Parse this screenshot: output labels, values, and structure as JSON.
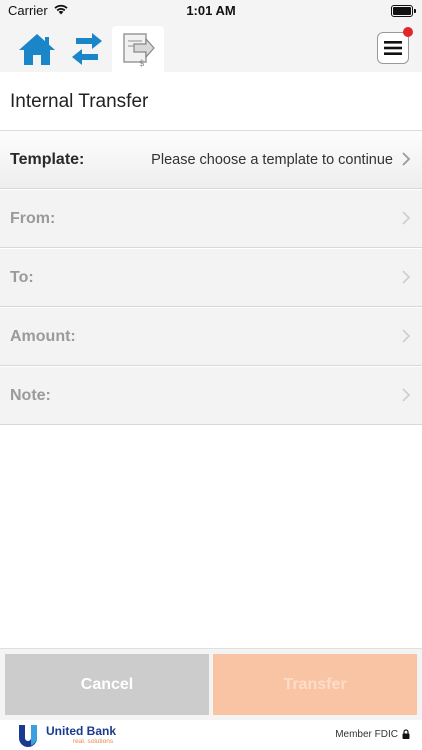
{
  "status_bar": {
    "carrier": "Carrier",
    "time": "1:01 AM"
  },
  "toolbar": {
    "items": [
      {
        "icon": "home-icon"
      },
      {
        "icon": "transfer-arrows-icon"
      },
      {
        "icon": "transfer-template-icon",
        "selected": true
      }
    ],
    "menu_icon": "hamburger-menu-icon",
    "notification_color": "#e32626"
  },
  "page": {
    "title": "Internal Transfer"
  },
  "form": {
    "rows": [
      {
        "label": "Template:",
        "value": "Please choose a template to continue",
        "enabled": true
      },
      {
        "label": "From:",
        "value": "",
        "enabled": false
      },
      {
        "label": "To:",
        "value": "",
        "enabled": false
      },
      {
        "label": "Amount:",
        "value": "",
        "enabled": false
      },
      {
        "label": "Note:",
        "value": "",
        "enabled": false
      }
    ]
  },
  "actions": {
    "cancel_label": "Cancel",
    "transfer_label": "Transfer",
    "cancel_color": "#cccccc",
    "transfer_color": "#f9c4a4"
  },
  "footer": {
    "bank_name": "United Bank",
    "tagline": "real. solutions",
    "fdic": "Member FDIC",
    "brand_color": "#1a3a8f",
    "accent_color": "#e58a4e"
  }
}
